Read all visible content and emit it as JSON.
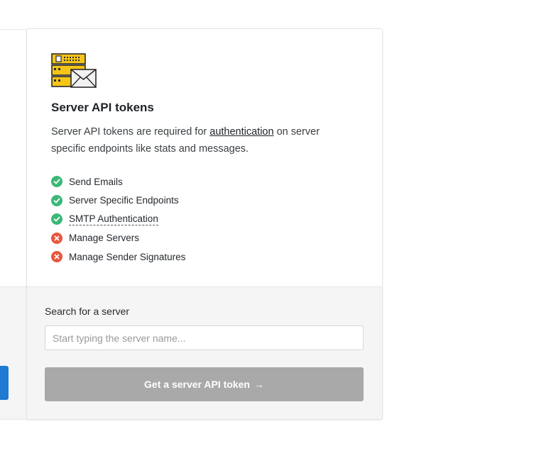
{
  "panel": {
    "icon": "server-mail-icon",
    "title": "Server API tokens",
    "desc_before": "Server API tokens are required for ",
    "desc_link": "authentication",
    "desc_after": " on server specific endpoints like stats and messages.",
    "features": [
      {
        "label": "Send Emails",
        "status": "check-icon"
      },
      {
        "label": "Server Specific Endpoints",
        "status": "check-icon"
      },
      {
        "label": "SMTP Authentication",
        "status": "check-icon"
      },
      {
        "label": "Manage Servers",
        "status": "x-icon"
      },
      {
        "label": "Manage Sender Signatures",
        "status": "x-icon"
      }
    ]
  },
  "search": {
    "label": "Search for a server",
    "placeholder": "Start typing the server name..."
  },
  "button": {
    "label": "Get a server API token",
    "arrow": "→"
  },
  "colors": {
    "check": "#3cb878",
    "cross": "#e9573f",
    "button_disabled": "#a9a9a9",
    "left_button": "#1f7ad1",
    "icon_yellow": "#f5c518"
  }
}
